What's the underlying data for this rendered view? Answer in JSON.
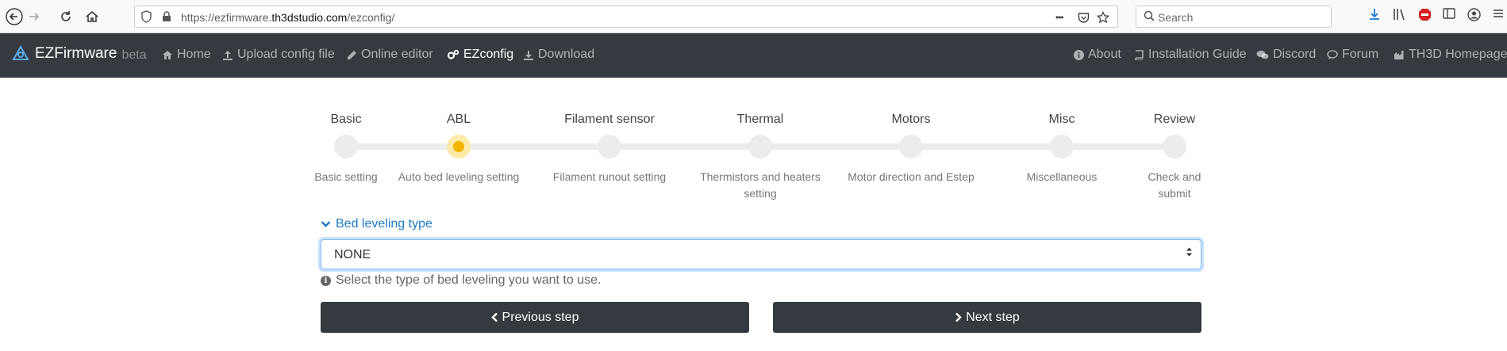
{
  "browser": {
    "url_prefix": "https://ezfirmware.",
    "url_domain": "th3dstudio.com",
    "url_path": "/ezconfig/",
    "search_placeholder": "Search",
    "more_glyph": "•••"
  },
  "navbar": {
    "brand": "EZFirmware",
    "brand_tag": "beta",
    "left_items": [
      {
        "label": "Home",
        "icon": "home-icon"
      },
      {
        "label": "Upload config file",
        "icon": "upload-icon"
      },
      {
        "label": "Online editor",
        "icon": "pencil-icon"
      },
      {
        "label": "EZconfig",
        "icon": "cogs-icon"
      },
      {
        "label": "Download",
        "icon": "download-icon"
      }
    ],
    "right_items": [
      {
        "label": "About",
        "icon": "info-icon"
      },
      {
        "label": "Installation Guide",
        "icon": "book-icon"
      },
      {
        "label": "Discord",
        "icon": "comments-icon"
      },
      {
        "label": "Forum",
        "icon": "comment-icon"
      },
      {
        "label": "TH3D Homepage",
        "icon": "building-icon"
      }
    ]
  },
  "stepper": {
    "active_index": 1,
    "steps": [
      {
        "title": "Basic",
        "desc": "Basic setting"
      },
      {
        "title": "ABL",
        "desc": "Auto bed leveling setting"
      },
      {
        "title": "Filament sensor",
        "desc": "Filament runout setting"
      },
      {
        "title": "Thermal",
        "desc": "Thermistors and heaters setting"
      },
      {
        "title": "Motors",
        "desc": "Motor direction and Estep"
      },
      {
        "title": "Misc",
        "desc": "Miscellaneous"
      },
      {
        "title": "Review",
        "desc": "Check and submit"
      }
    ]
  },
  "form": {
    "section_label": "Bed leveling type",
    "select_value": "NONE",
    "help_text": "Select the type of bed leveling you want to use."
  },
  "buttons": {
    "previous": "Previous step",
    "next": "Next step"
  },
  "colors": {
    "navbar_bg": "#343a40",
    "active_step": "#f4b400",
    "link": "#1f7ac2"
  }
}
